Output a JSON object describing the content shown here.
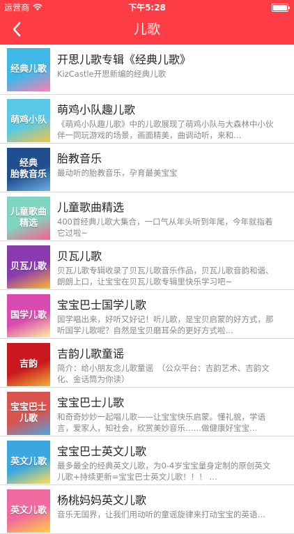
{
  "status_bar": {
    "carrier": "运营商",
    "time": "下午5:28"
  },
  "nav": {
    "title": "儿歌"
  },
  "colors": {
    "header": "#fd3c45"
  },
  "items": [
    {
      "title": "开思儿歌专辑《经典儿歌》",
      "desc": "KizCastle开思新编的经典儿歌",
      "thumb_label": "经典儿歌",
      "thumb_bg": "#3fb8e8",
      "thumb_accent": "#ff7fb0"
    },
    {
      "title": "萌鸡小队趣儿歌",
      "desc": "《萌鸡小队趣儿歌》中的儿歌展现了萌鸡小队与大森林中小伙伴一同玩游戏的场景，画面精美，曲调动听，来和…",
      "thumb_label": "萌鸡小队",
      "thumb_bg": "#57c8e6",
      "thumb_accent": "#f7c640"
    },
    {
      "title": "胎教音乐",
      "desc": "最动听的胎教音乐，孕育最美宝宝",
      "thumb_label": "经典\n胎教音乐",
      "thumb_bg": "#1f4f8f",
      "thumb_accent": "#6fb0e8"
    },
    {
      "title": "儿童歌曲精选",
      "desc": "400首经典儿歌大集合，一口气从年头听到年尾，今年就指着它过啦~",
      "thumb_label": "儿童歌曲\n精选",
      "thumb_bg": "#7fd6c0",
      "thumb_accent": "#ff5c8a"
    },
    {
      "title": "贝瓦儿歌",
      "desc": "贝瓦儿歌专辑收录了贝瓦儿歌音乐作品，贝瓦儿歌音韵和谐、朗朗上口，让宝宝在贝瓦儿歌专辑里快乐学习吧~",
      "thumb_label": "贝瓦儿歌",
      "thumb_bg": "#8a3bb0",
      "thumb_accent": "#ffb52e"
    },
    {
      "title": "宝宝巴士国学儿歌",
      "desc": "国学唱出来，好听又好记！听儿歌，是宝贝启蒙的好方式，那听国学儿歌呢？自然是宝贝磨耳朵的更好方式啦…",
      "thumb_label": "国学儿歌",
      "thumb_bg": "#d84bb0",
      "thumb_accent": "#fff0a0"
    },
    {
      "title": "吉韵儿歌童谣",
      "desc": "简介：给小朋友念儿歌童谣　（公众平台：吉韵艺术、吉韵文化、金话筒为你读）",
      "thumb_label": "吉韵",
      "thumb_bg": "#c9181e",
      "thumb_accent": "#f2b23a"
    },
    {
      "title": "宝宝巴士儿歌",
      "desc": "和奇奇妙妙一起唱儿歌——让宝宝快乐启蒙。懂礼貌，学语言，爱家人，知社会，欣赏美妙音乐……做健康好宝宝…",
      "thumb_label": "宝宝巴士\n儿歌",
      "thumb_bg": "#d9534f",
      "thumb_accent": "#4fa6e0"
    },
    {
      "title": "宝宝巴士英文儿歌",
      "desc": "最多最全的经典英文儿歌，为0-4岁宝宝量身定制的原创英文儿歌+持续更新=宝宝巴士英文儿歌！！！ …",
      "thumb_label": "英文儿歌",
      "thumb_bg": "#3aa7e0",
      "thumb_accent": "#ffe14f"
    },
    {
      "title": "杨桃妈妈英文儿歌",
      "desc": "音乐无国界，让我们用动听的童谣旋律来打动宝宝的英语…",
      "thumb_label": "英文儿歌",
      "thumb_bg": "#f06a9f",
      "thumb_accent": "#ffd23f"
    }
  ]
}
